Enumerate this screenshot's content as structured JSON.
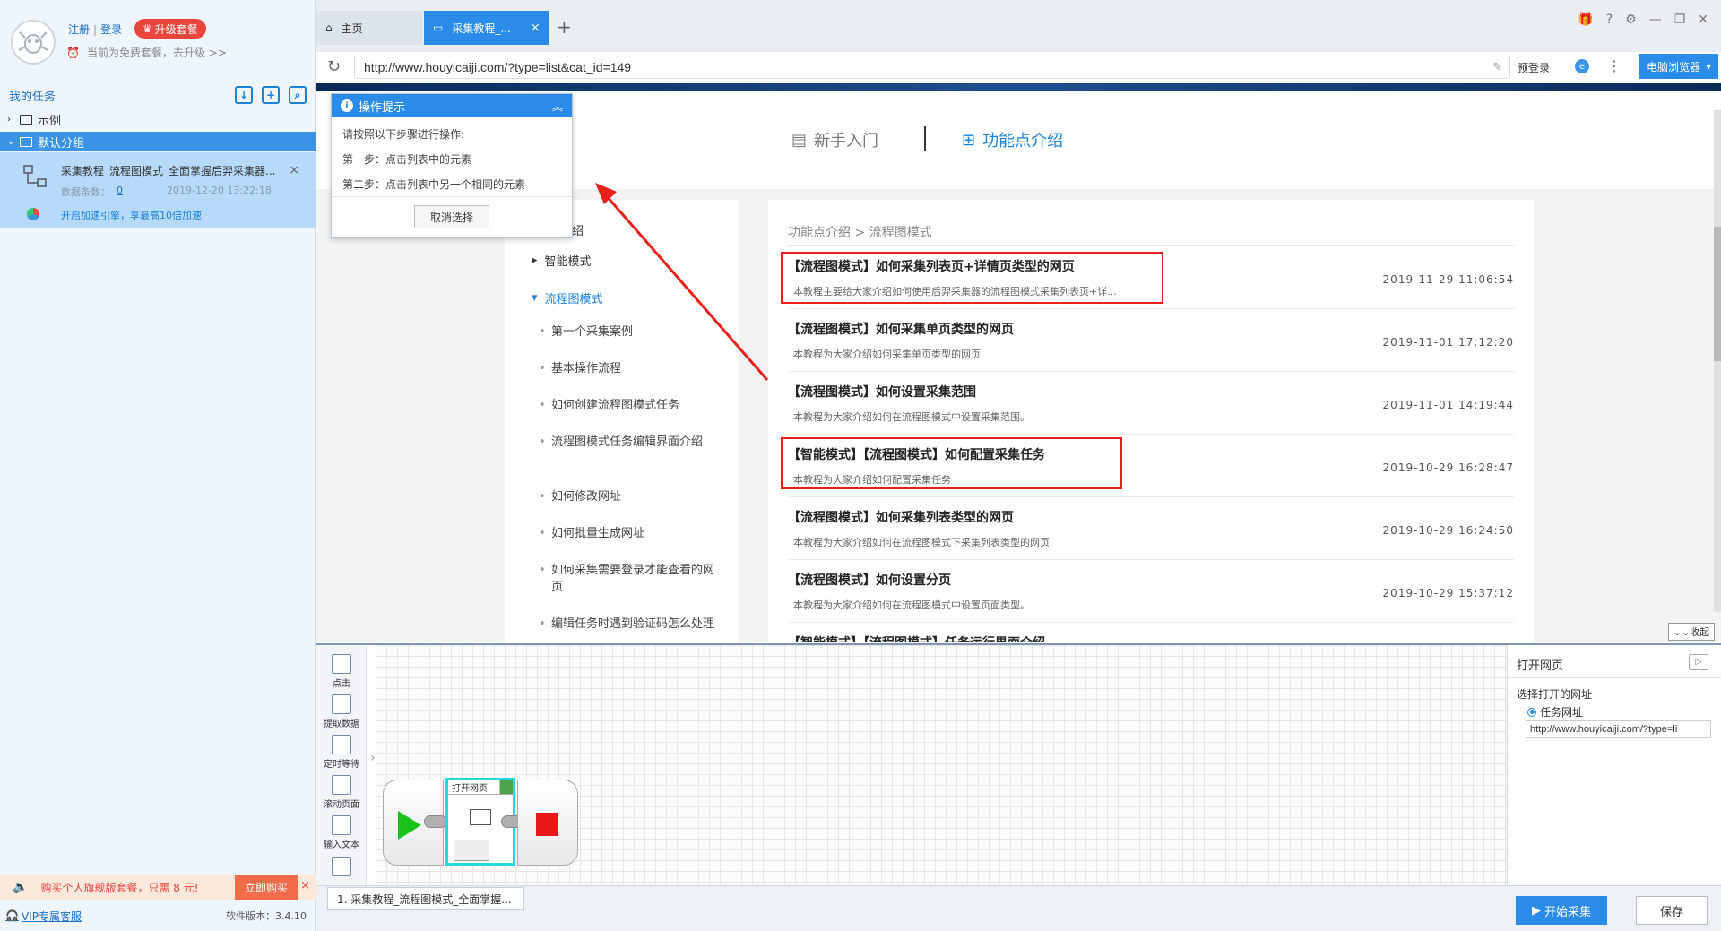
{
  "sidebar": {
    "register": "注册",
    "login": "登录",
    "sep": "|",
    "upgrade": "升级套餐",
    "plan_note": "当前为免费套餐，去升级 >>",
    "tasks_title": "我的任务",
    "tree_example": "示例",
    "tree_default": "默认分组",
    "task": {
      "title": "采集教程_流程图模式_全面掌握后羿采集器...",
      "count_label": "数据条数：",
      "count": "0",
      "time": "2019-12-20 13:22:18",
      "accel": "开启加速引擎，享最高10倍加速"
    },
    "promo": {
      "text": "购买个人旗舰版套餐，只需 8 元!",
      "buy": "立即购买"
    },
    "vip": "VIP专属客服",
    "version": "软件版本：3.4.10"
  },
  "tabs": {
    "home": "主页",
    "active": "采集教程_..."
  },
  "address": {
    "url": "http://www.houyicaiji.com/?type=list&cat_id=149",
    "prelogin": "预登录",
    "browser": "电脑浏览器"
  },
  "web": {
    "nav_newbie": "新手入门",
    "nav_features": "功能点介绍",
    "menu": {
      "intro": "介绍",
      "smart": "智能模式",
      "flow": "流程图模式",
      "items": [
        "第一个采集案例",
        "基本操作流程",
        "如何创建流程图模式任务",
        "流程图模式任务编辑界面介绍",
        "如何修改网址",
        "如何批量生成网址",
        "如何采集需要登录才能查看的网页",
        "编辑任务时遇到验证码怎么处理"
      ]
    },
    "breadcrumb": "功能点介绍 > 流程图模式",
    "articles": [
      {
        "title": "【流程图模式】如何采集列表页+详情页类型的网页",
        "desc": "本教程主要给大家介绍如何使用后羿采集器的流程图模式采集列表页+详...",
        "date": "2019-11-29 11:06:54"
      },
      {
        "title": "【流程图模式】如何采集单页类型的网页",
        "desc": "本教程为大家介绍如何采集单页类型的网页",
        "date": "2019-11-01 17:12:20"
      },
      {
        "title": "【流程图模式】如何设置采集范围",
        "desc": "本教程为大家介绍如何在流程图模式中设置采集范围。",
        "date": "2019-11-01 14:19:44"
      },
      {
        "title": "【智能模式】【流程图模式】如何配置采集任务",
        "desc": "本教程为大家介绍如何配置采集任务",
        "date": "2019-10-29 16:28:47"
      },
      {
        "title": "【流程图模式】如何采集列表类型的网页",
        "desc": "本教程为大家介绍如何在流程图模式下采集列表类型的网页",
        "date": "2019-10-29 16:24:50"
      },
      {
        "title": "【流程图模式】如何设置分页",
        "desc": "本教程为大家介绍如何在流程图模式中设置页面类型。",
        "date": "2019-10-29 15:37:12"
      },
      {
        "title": "【智能模式】【流程图模式】任务运行界面介绍",
        "desc": "",
        "date": ""
      }
    ],
    "collapse": "收起"
  },
  "tip": {
    "title": "操作提示",
    "line1": "请按照以下步骤进行操作:",
    "line2": "第一步：点击列表中的元素",
    "line3": "第二步：点击列表中另一个相同的元素",
    "cancel": "取消选择"
  },
  "designer": {
    "tools": [
      "点击",
      "提取数据",
      "定时等待",
      "滚动页面",
      "输入文本"
    ],
    "node_title": "打开网页",
    "props": {
      "title": "打开网页",
      "select_label": "选择打开的网址",
      "radio": "任务网址",
      "url": "http://www.houyicaiji.com/?type=li"
    }
  },
  "bottom": {
    "tab": "1. 采集教程_流程图模式_全面掌握...",
    "start": "开始采集",
    "save": "保存"
  },
  "colors": {
    "accent": "#2b8be8",
    "highlight_box": "#e8201a",
    "promo": "#e8453c"
  }
}
